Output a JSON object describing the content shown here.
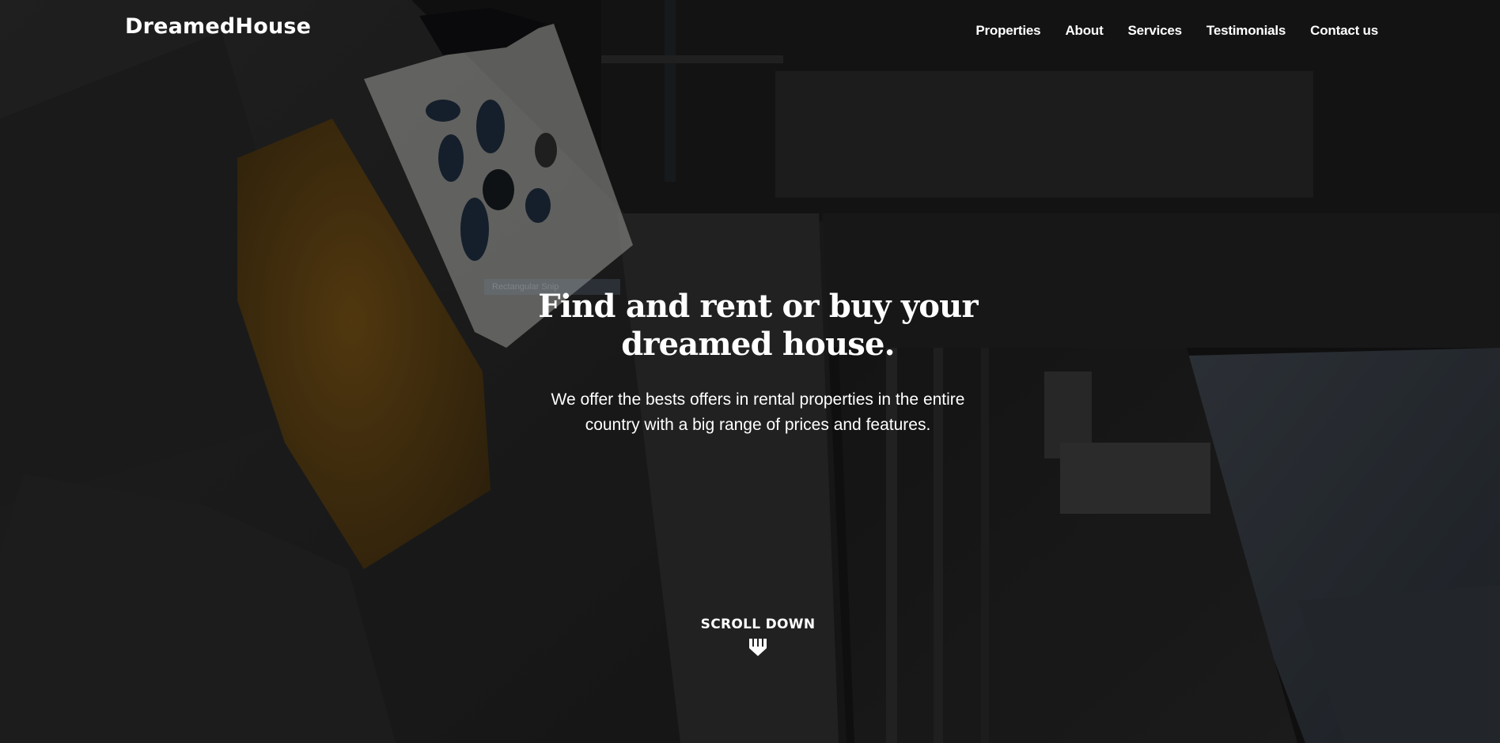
{
  "brand": {
    "name": "DreamedHouse"
  },
  "nav": {
    "items": [
      {
        "label": "Properties"
      },
      {
        "label": "About"
      },
      {
        "label": "Services"
      },
      {
        "label": "Testimonials"
      },
      {
        "label": "Contact us"
      }
    ]
  },
  "hero": {
    "title": "Find and rent or buy your dreamed house.",
    "subtitle": "We offer the bests offers in rental properties in the entire country with a big range of prices and features.",
    "ghost_tag": "Rectangular Snip"
  },
  "scroll": {
    "label": "SCROLL DOWN",
    "icon": "scroll-down-arrow-icon"
  },
  "colors": {
    "text": "#ffffff",
    "background": "#111111",
    "cushion_accent": "#6b4a14"
  }
}
